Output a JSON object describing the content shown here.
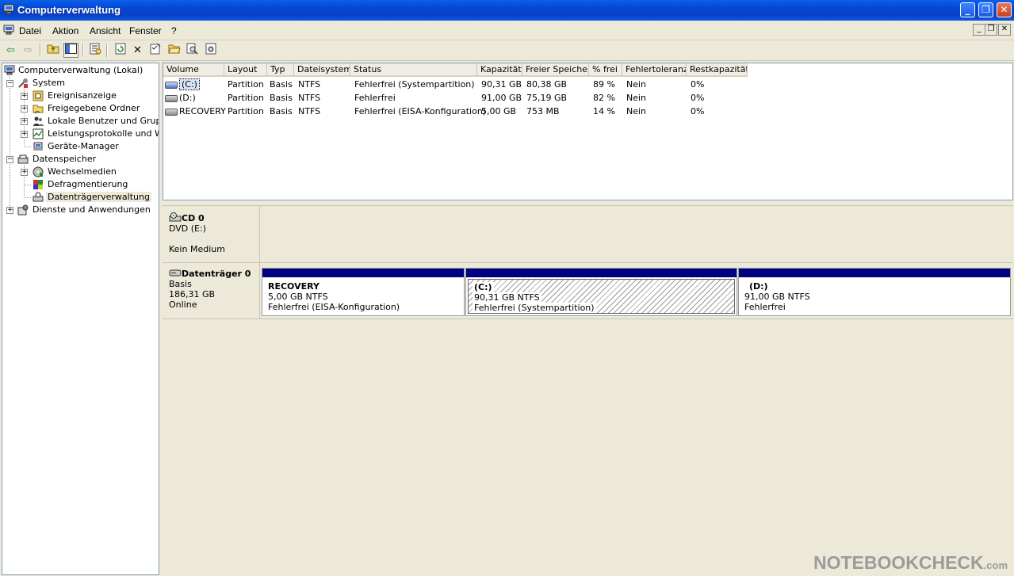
{
  "window": {
    "title": "Computerverwaltung"
  },
  "menu": {
    "items": [
      "Datei",
      "Aktion",
      "Ansicht",
      "Fenster",
      "?"
    ]
  },
  "tree": {
    "root": "Computerverwaltung (Lokal)",
    "items": [
      "System",
      "Ereignisanzeige",
      "Freigegebene Ordner",
      "Lokale Benutzer und Gruppen",
      "Leistungsprotokolle und Warnungen",
      "Geräte-Manager",
      "Datenspeicher",
      "Wechselmedien",
      "Defragmentierung",
      "Datenträgerverwaltung",
      "Dienste und Anwendungen"
    ],
    "selected": "Datenträgerverwaltung"
  },
  "volumes": {
    "columns": [
      "Volume",
      "Layout",
      "Typ",
      "Dateisystem",
      "Status",
      "Kapazität",
      "Freier Speicher",
      "% frei",
      "Fehlertoleranz",
      "Restkapazität"
    ],
    "rows": [
      [
        "(C:)",
        "Partition",
        "Basis",
        "NTFS",
        "Fehlerfrei (Systempartition)",
        "90,31 GB",
        "80,38 GB",
        "89 %",
        "Nein",
        "0%"
      ],
      [
        "(D:)",
        "Partition",
        "Basis",
        "NTFS",
        "Fehlerfrei",
        "91,00 GB",
        "75,19 GB",
        "82 %",
        "Nein",
        "0%"
      ],
      [
        "RECOVERY",
        "Partition",
        "Basis",
        "NTFS",
        "Fehlerfrei (EISA-Konfiguration)",
        "5,00 GB",
        "753 MB",
        "14 %",
        "Nein",
        "0%"
      ]
    ]
  },
  "disks": {
    "cd": {
      "name": "CD 0",
      "type": "DVD (E:)",
      "state": "Kein Medium"
    },
    "disk0": {
      "name": "Datenträger 0",
      "type": "Basis",
      "size": "186,31 GB",
      "state": "Online",
      "partitions": [
        {
          "name": "RECOVERY",
          "size": "5,00 GB NTFS",
          "status": "Fehlerfrei (EISA-Konfiguration)"
        },
        {
          "name": "(C:)",
          "size": "90,31 GB NTFS",
          "status": "Fehlerfrei (Systempartition)"
        },
        {
          "name": "(D:)",
          "size": "91,00 GB NTFS",
          "status": "Fehlerfrei"
        }
      ]
    }
  },
  "watermark": {
    "main": "NOTEBOOKCHECK",
    "suffix": ".com"
  },
  "colors": {
    "partition_bar": "#000080",
    "titlebar": "#0A52DA"
  }
}
